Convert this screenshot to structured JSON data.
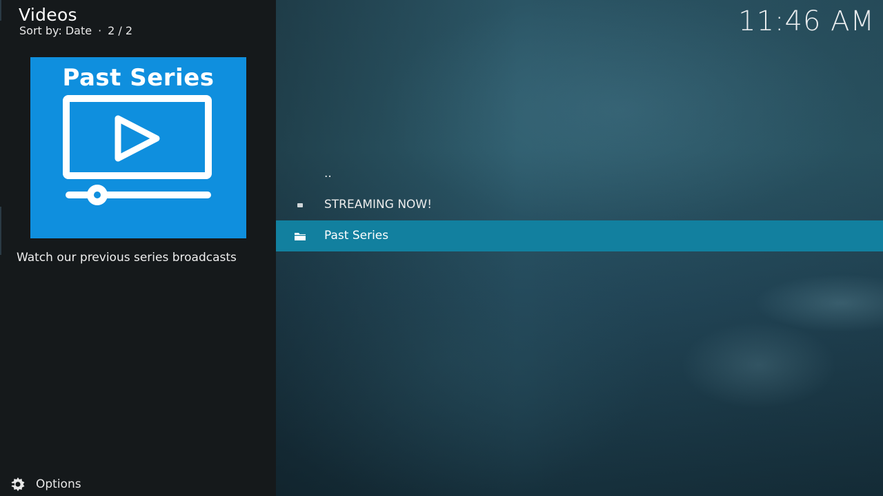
{
  "header": {
    "title": "Videos",
    "sort_label": "Sort by: Date",
    "separator": "·",
    "position": "2 / 2"
  },
  "clock": {
    "time": "11:46 AM"
  },
  "poster": {
    "title": "Past Series",
    "icon": "video-player-icon",
    "background_color": "#0f8fde"
  },
  "plot": {
    "text": "Watch our previous series broadcasts"
  },
  "list": {
    "items": [
      {
        "label": "..",
        "icon": "none"
      },
      {
        "label": "STREAMING NOW!",
        "icon": "file-bullet-icon"
      },
      {
        "label": "Past Series",
        "icon": "folder-icon",
        "selected": true
      }
    ],
    "highlight_color": "#12809f"
  },
  "footer": {
    "options_label": "Options",
    "icon": "options-gear-icon"
  }
}
